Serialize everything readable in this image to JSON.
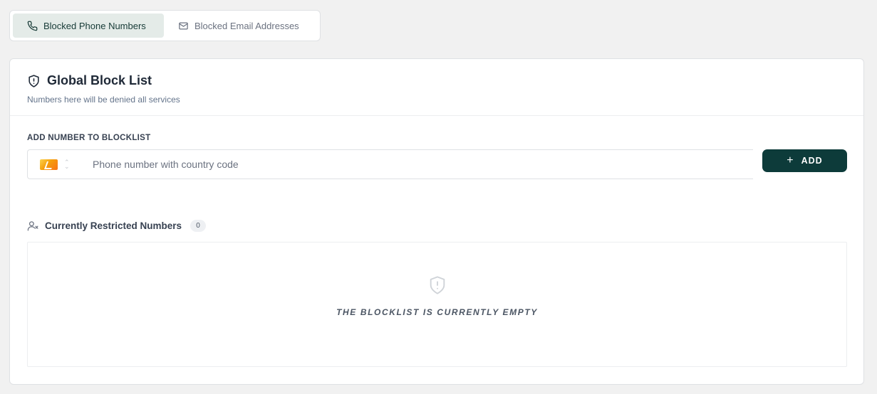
{
  "tabs": [
    {
      "label": "Blocked Phone Numbers",
      "icon": "phone-icon",
      "active": true
    },
    {
      "label": "Blocked Email Addresses",
      "icon": "mail-icon",
      "active": false
    }
  ],
  "card": {
    "title": "Global Block List",
    "title_icon": "shield-alert-icon",
    "subtitle": "Numbers here will be denied all services"
  },
  "add_form": {
    "label": "ADD NUMBER TO BLOCKLIST",
    "country_flag": "flag-icon",
    "phone_placeholder": "Phone number with country code",
    "phone_value": "",
    "add_button": "ADD"
  },
  "restricted": {
    "title": "Currently Restricted Numbers",
    "icon": "user-x-icon",
    "count": "0",
    "empty_message": "THE BLOCKLIST IS CURRENTLY EMPTY",
    "empty_icon": "shield-alert-icon"
  },
  "colors": {
    "accent": "#0d3b3a",
    "active_tab_bg": "#e4ebe8",
    "page_bg": "#f1f1f1"
  }
}
